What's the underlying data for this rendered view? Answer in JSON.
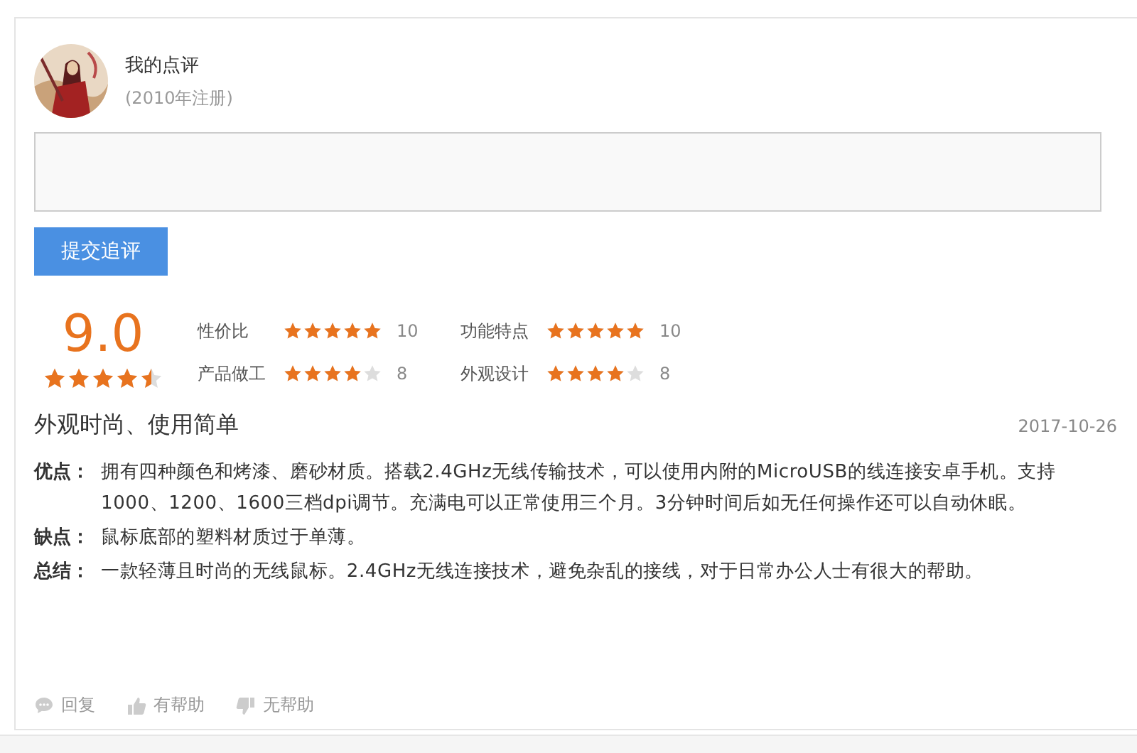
{
  "user": {
    "name": "我的点评",
    "registered": "(2010年注册)"
  },
  "follow_up": {
    "button": "提交追评"
  },
  "score": {
    "value": "9.0",
    "stars": 4.5
  },
  "sub_ratings": [
    {
      "label": "性价比",
      "stars": 5,
      "value": "10"
    },
    {
      "label": "功能特点",
      "stars": 5,
      "value": "10"
    },
    {
      "label": "产品做工",
      "stars": 4,
      "value": "8"
    },
    {
      "label": "外观设计",
      "stars": 4,
      "value": "8"
    }
  ],
  "review": {
    "title": "外观时尚、使用简单",
    "date": "2017-10-26",
    "sections": [
      {
        "label": "优点：",
        "text": "拥有四种颜色和烤漆、磨砂材质。搭载2.4GHz无线传输技术，可以使用内附的MicroUSB的线连接安卓手机。支持1000、1200、1600三档dpi调节。充满电可以正常使用三个月。3分钟时间后如无任何操作还可以自动休眠。"
      },
      {
        "label": "缺点：",
        "text": "鼠标底部的塑料材质过于单薄。"
      },
      {
        "label": "总结：",
        "text": "一款轻薄且时尚的无线鼠标。2.4GHz无线连接技术，避免杂乱的接线，对于日常办公人士有很大的帮助。"
      }
    ]
  },
  "actions": [
    {
      "kind": "reply",
      "label": "回复"
    },
    {
      "kind": "helpful",
      "label": "有帮助"
    },
    {
      "kind": "unhelpful",
      "label": "无帮助"
    }
  ]
}
